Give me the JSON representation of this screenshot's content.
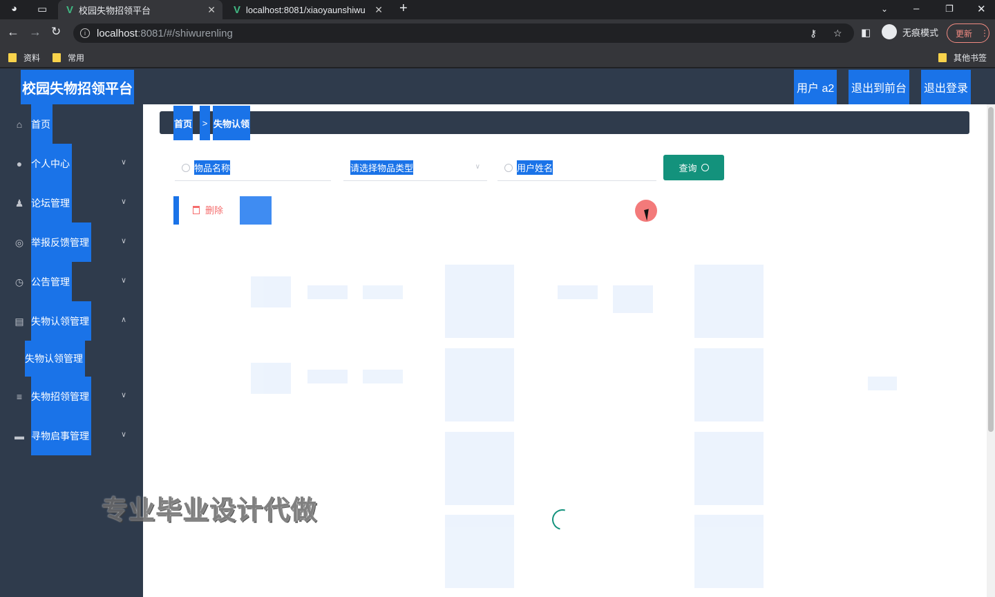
{
  "browser": {
    "tabs": [
      {
        "title": "校园失物招领平台",
        "active": true
      },
      {
        "title": "localhost:8081/xiaoyaunshiwu",
        "active": false
      }
    ],
    "url_host": "localhost",
    "url_path": ":8081/#/shiwurenling",
    "incognito_label": "无痕模式",
    "update_label": "更新",
    "bookmarks": [
      "资料",
      "常用"
    ],
    "other_bookmarks": "其他书签"
  },
  "header": {
    "brand": "校园失物招领平台",
    "user": "用户 a2",
    "to_front": "退出到前台",
    "logout": "退出登录"
  },
  "sidebar": {
    "items": [
      {
        "label": "首页",
        "icon": "home-icon"
      },
      {
        "label": "个人中心",
        "icon": "user-icon"
      },
      {
        "label": "论坛管理",
        "icon": "person-icon"
      },
      {
        "label": "举报反馈管理",
        "icon": "circle-icon"
      },
      {
        "label": "公告管理",
        "icon": "clock-icon"
      },
      {
        "label": "失物认领管理",
        "icon": "card-icon"
      },
      {
        "label": "失物招领管理",
        "icon": "list-icon"
      },
      {
        "label": "寻物启事管理",
        "icon": "monitor-icon"
      }
    ],
    "sub_item": "失物认领管理"
  },
  "breadcrumb": {
    "home": "首页",
    "separator": ">",
    "current": "失物认领"
  },
  "search": {
    "item_name_placeholder": "物品名称",
    "item_type_placeholder": "请选择物品类型",
    "user_name_placeholder": "用户姓名",
    "query_label": "查询"
  },
  "actions": {
    "delete_label": "删除"
  },
  "watermark": "专业毕业设计代做",
  "colors": {
    "sidebar_bg": "#2f3b4c",
    "highlight": "#1a73e8",
    "query_btn": "#13927c",
    "delete": "#f56c6c"
  }
}
